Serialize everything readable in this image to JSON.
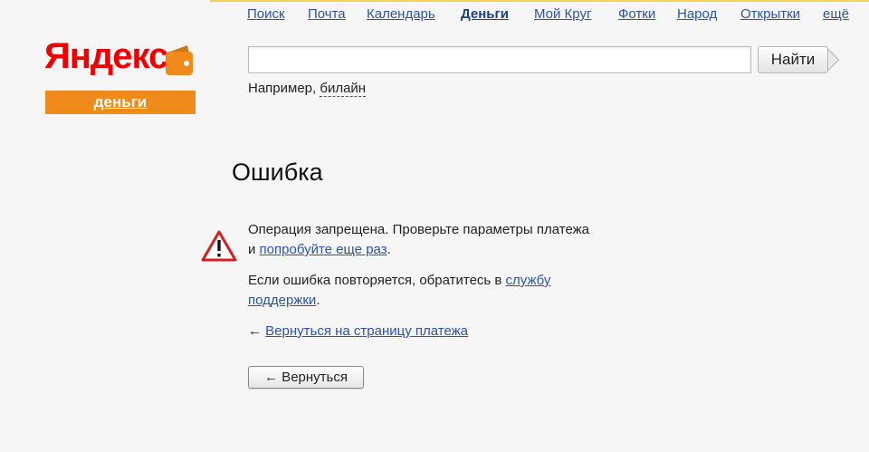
{
  "nav": {
    "tabs": [
      {
        "label": "Поиск"
      },
      {
        "label": "Почта"
      },
      {
        "label": "Календарь"
      },
      {
        "label": "Деньги"
      },
      {
        "label": "Мой Круг"
      },
      {
        "label": "Фотки"
      },
      {
        "label": "Народ"
      },
      {
        "label": "Открытки"
      },
      {
        "label": "ещё"
      }
    ],
    "active_tab": "Деньги"
  },
  "logo": {
    "word_first": "Я",
    "word_rest": "ндекс",
    "service": "деньги",
    "brand_red": "#ee0000",
    "brand_orange": "#f08a1a"
  },
  "search": {
    "value": "",
    "button_label": "Найти",
    "example_prefix": "Например, ",
    "example_value": "билайн"
  },
  "error": {
    "title": "Ошибка",
    "icon": "warning-icon",
    "line1": "Операция запрещена. Проверьте параметры платежа",
    "line2_prefix": "и ",
    "line2_link": "попробуйте еще раз",
    "line2_suffix": ".",
    "support_prefix": "Если ошибка повторяется, обратитесь в ",
    "support_link_1": "службу",
    "support_link_2": "поддержки",
    "support_suffix": ".",
    "back_arrow": "←",
    "back_link": "Вернуться на страницу платежа",
    "back_button": "← Вернуться"
  }
}
